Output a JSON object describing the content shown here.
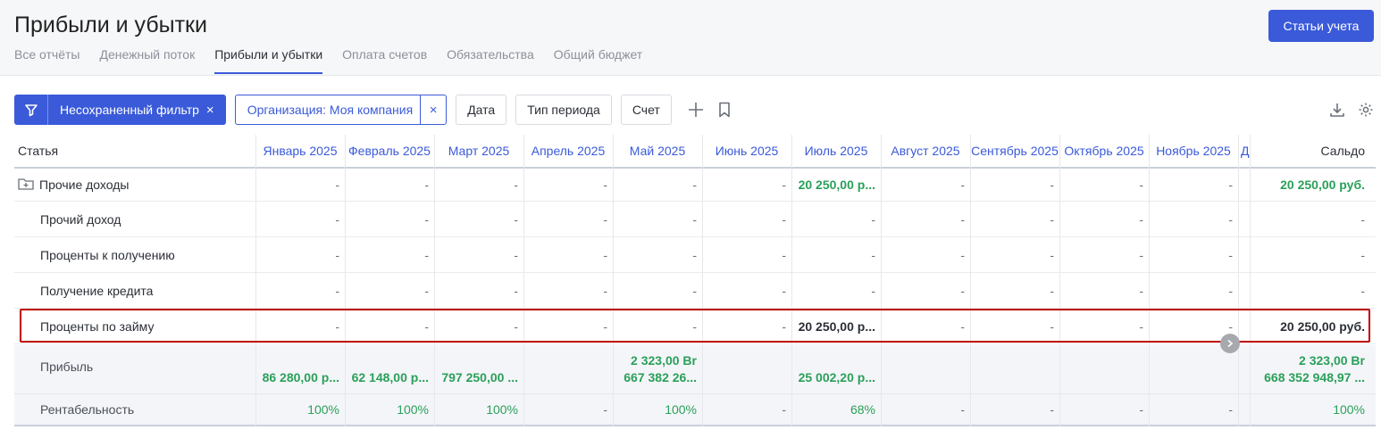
{
  "page": {
    "title": "Прибыли и убытки",
    "accounts_button": "Статьи учета",
    "tabs": [
      "Все отчёты",
      "Денежный поток",
      "Прибыли и убытки",
      "Оплата счетов",
      "Обязательства",
      "Общий бюджет"
    ],
    "active_tab": "Прибыли и убытки"
  },
  "filters": {
    "unsaved_filter": "Несохраненный фильтр",
    "close_glyph": "×",
    "organization": "Организация: Моя компания",
    "date": "Дата",
    "period_type": "Тип периода",
    "account": "Счет"
  },
  "table": {
    "article_header": "Статья",
    "balance_header": "Сальдо",
    "months": [
      "Январь 2025",
      "Февраль 2025",
      "Март 2025",
      "Апрель 2025",
      "Май 2025",
      "Июнь 2025",
      "Июль 2025",
      "Август 2025",
      "Сентябрь 2025",
      "Октябрь 2025",
      "Ноябрь 2025"
    ],
    "next_month_partial": "Д",
    "rows": [
      {
        "name": "Прочие доходы",
        "group": true,
        "values": [
          "-",
          "-",
          "-",
          "-",
          "-",
          "-",
          "20 250,00 р...",
          "-",
          "-",
          "-",
          "-"
        ],
        "balance": "20 250,00 руб."
      },
      {
        "name": "Прочий доход",
        "values": [
          "-",
          "-",
          "-",
          "-",
          "-",
          "-",
          "-",
          "-",
          "-",
          "-",
          "-"
        ],
        "balance": "-"
      },
      {
        "name": "Проценты к получению",
        "values": [
          "-",
          "-",
          "-",
          "-",
          "-",
          "-",
          "-",
          "-",
          "-",
          "-",
          "-"
        ],
        "balance": "-"
      },
      {
        "name": "Получение кредита",
        "values": [
          "-",
          "-",
          "-",
          "-",
          "-",
          "-",
          "-",
          "-",
          "-",
          "-",
          "-"
        ],
        "balance": "-"
      },
      {
        "name": "Проценты по займу",
        "highlighted": true,
        "values": [
          "-",
          "-",
          "-",
          "-",
          "-",
          "-",
          "20 250,00 р...",
          "-",
          "-",
          "-",
          "-"
        ],
        "balance": "20 250,00 руб."
      }
    ],
    "profit": {
      "label": "Прибыль",
      "values": [
        [
          "86 280,00 р..."
        ],
        [
          "62 148,00 р..."
        ],
        [
          "797 250,00 ..."
        ],
        [],
        [
          "2 323,00 Br",
          "667 382 26..."
        ],
        [],
        [
          "25 002,20 р..."
        ],
        [],
        [],
        [],
        []
      ],
      "balance": [
        "2 323,00 Br",
        "668 352 948,97 ..."
      ]
    },
    "profitability": {
      "label": "Рентабельность",
      "values": [
        "100%",
        "100%",
        "100%",
        "-",
        "100%",
        "-",
        "68%",
        "-",
        "-",
        "-",
        "-"
      ],
      "balance": "100%"
    }
  },
  "colors": {
    "accent": "#3a5ad9",
    "positive": "#2aa05a",
    "highlight": "#c00000"
  }
}
